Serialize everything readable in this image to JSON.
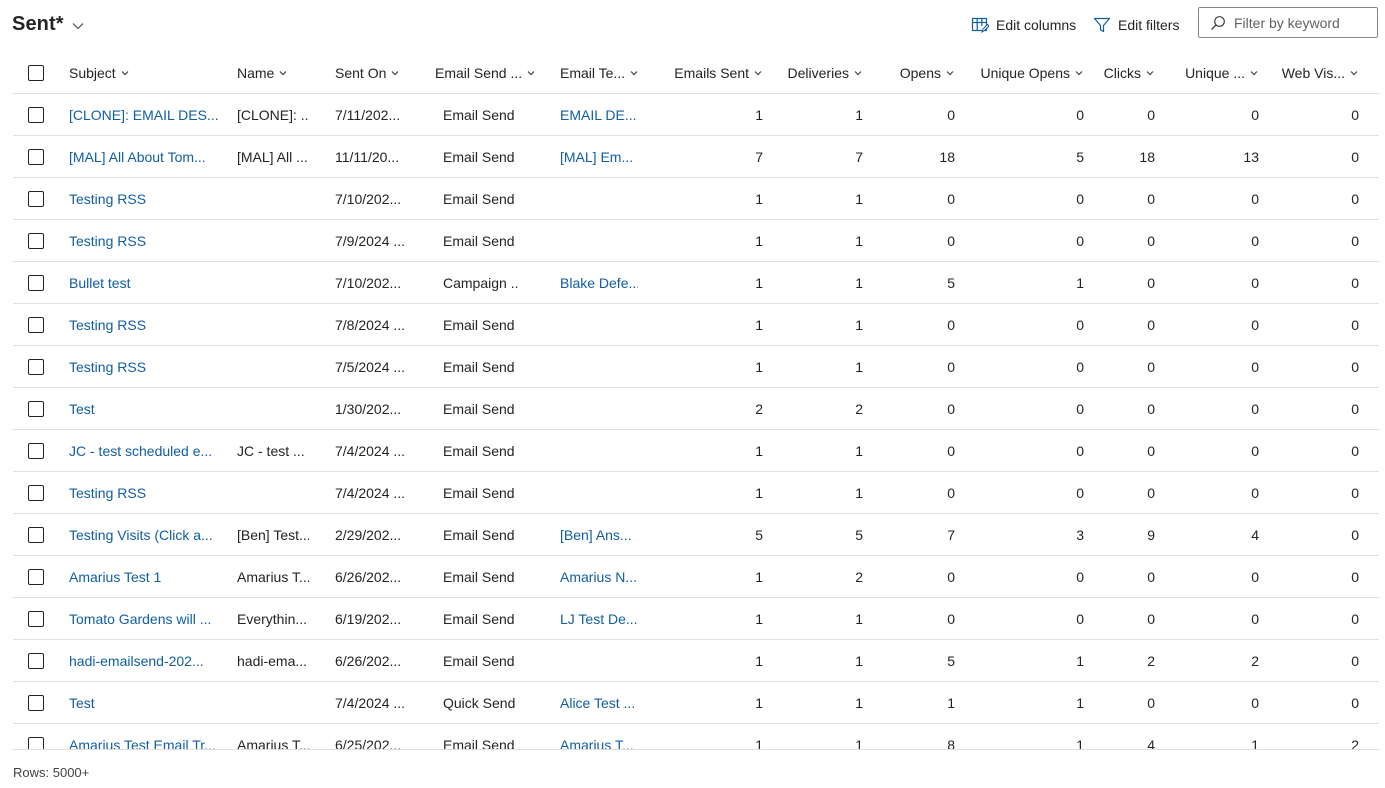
{
  "view": {
    "title": "Sent*"
  },
  "toolbar": {
    "edit_columns": "Edit columns",
    "edit_filters": "Edit filters"
  },
  "search": {
    "placeholder": "Filter by keyword"
  },
  "columns": [
    {
      "key": "subject",
      "label": "Subject"
    },
    {
      "key": "name",
      "label": "Name"
    },
    {
      "key": "sent_on",
      "label": "Sent On"
    },
    {
      "key": "email_send",
      "label": "Email Send ..."
    },
    {
      "key": "email_template",
      "label": "Email Te..."
    },
    {
      "key": "emails_sent",
      "label": "Emails Sent"
    },
    {
      "key": "deliveries",
      "label": "Deliveries"
    },
    {
      "key": "opens",
      "label": "Opens"
    },
    {
      "key": "unique_opens",
      "label": "Unique Opens"
    },
    {
      "key": "clicks",
      "label": "Clicks"
    },
    {
      "key": "unique_clicks",
      "label": "Unique ..."
    },
    {
      "key": "web_visits",
      "label": "Web Vis..."
    }
  ],
  "rows": [
    {
      "subject": "[CLONE]: EMAIL DES...",
      "name": "[CLONE]: ...",
      "sent_on": "7/11/202...",
      "email_send": "Email Send",
      "email_template": "EMAIL DE...",
      "emails_sent": "1",
      "deliveries": "1",
      "opens": "0",
      "unique_opens": "0",
      "clicks": "0",
      "unique_clicks": "0",
      "web_visits": "0"
    },
    {
      "subject": "[MAL] All About Tom...",
      "name": "[MAL] All ...",
      "sent_on": "11/11/20...",
      "email_send": "Email Send",
      "email_template": "[MAL] Em...",
      "emails_sent": "7",
      "deliveries": "7",
      "opens": "18",
      "unique_opens": "5",
      "clicks": "18",
      "unique_clicks": "13",
      "web_visits": "0"
    },
    {
      "subject": "Testing RSS",
      "name": "",
      "sent_on": "7/10/202...",
      "email_send": "Email Send",
      "email_template": "",
      "emails_sent": "1",
      "deliveries": "1",
      "opens": "0",
      "unique_opens": "0",
      "clicks": "0",
      "unique_clicks": "0",
      "web_visits": "0"
    },
    {
      "subject": "Testing RSS",
      "name": "",
      "sent_on": "7/9/2024 ...",
      "email_send": "Email Send",
      "email_template": "",
      "emails_sent": "1",
      "deliveries": "1",
      "opens": "0",
      "unique_opens": "0",
      "clicks": "0",
      "unique_clicks": "0",
      "web_visits": "0"
    },
    {
      "subject": "Bullet test",
      "name": "",
      "sent_on": "7/10/202...",
      "email_send": "Campaign ...",
      "email_template": "Blake Defe...",
      "emails_sent": "1",
      "deliveries": "1",
      "opens": "5",
      "unique_opens": "1",
      "clicks": "0",
      "unique_clicks": "0",
      "web_visits": "0"
    },
    {
      "subject": "Testing RSS",
      "name": "",
      "sent_on": "7/8/2024 ...",
      "email_send": "Email Send",
      "email_template": "",
      "emails_sent": "1",
      "deliveries": "1",
      "opens": "0",
      "unique_opens": "0",
      "clicks": "0",
      "unique_clicks": "0",
      "web_visits": "0"
    },
    {
      "subject": "Testing RSS",
      "name": "",
      "sent_on": "7/5/2024 ...",
      "email_send": "Email Send",
      "email_template": "",
      "emails_sent": "1",
      "deliveries": "1",
      "opens": "0",
      "unique_opens": "0",
      "clicks": "0",
      "unique_clicks": "0",
      "web_visits": "0"
    },
    {
      "subject": "Test",
      "name": "",
      "sent_on": "1/30/202...",
      "email_send": "Email Send",
      "email_template": "",
      "emails_sent": "2",
      "deliveries": "2",
      "opens": "0",
      "unique_opens": "0",
      "clicks": "0",
      "unique_clicks": "0",
      "web_visits": "0"
    },
    {
      "subject": "JC - test scheduled e...",
      "name": "JC - test ...",
      "sent_on": "7/4/2024 ...",
      "email_send": "Email Send",
      "email_template": "",
      "emails_sent": "1",
      "deliveries": "1",
      "opens": "0",
      "unique_opens": "0",
      "clicks": "0",
      "unique_clicks": "0",
      "web_visits": "0"
    },
    {
      "subject": "Testing RSS",
      "name": "",
      "sent_on": "7/4/2024 ...",
      "email_send": "Email Send",
      "email_template": "",
      "emails_sent": "1",
      "deliveries": "1",
      "opens": "0",
      "unique_opens": "0",
      "clicks": "0",
      "unique_clicks": "0",
      "web_visits": "0"
    },
    {
      "subject": "Testing Visits (Click a...",
      "name": "[Ben] Test...",
      "sent_on": "2/29/202...",
      "email_send": "Email Send",
      "email_template": "[Ben] Ans...",
      "emails_sent": "5",
      "deliveries": "5",
      "opens": "7",
      "unique_opens": "3",
      "clicks": "9",
      "unique_clicks": "4",
      "web_visits": "0"
    },
    {
      "subject": "Amarius Test 1",
      "name": "Amarius T...",
      "sent_on": "6/26/202...",
      "email_send": "Email Send",
      "email_template": "Amarius N...",
      "emails_sent": "1",
      "deliveries": "2",
      "opens": "0",
      "unique_opens": "0",
      "clicks": "0",
      "unique_clicks": "0",
      "web_visits": "0"
    },
    {
      "subject": "Tomato Gardens will ...",
      "name": "Everythin...",
      "sent_on": "6/19/202...",
      "email_send": "Email Send",
      "email_template": "LJ Test De...",
      "emails_sent": "1",
      "deliveries": "1",
      "opens": "0",
      "unique_opens": "0",
      "clicks": "0",
      "unique_clicks": "0",
      "web_visits": "0"
    },
    {
      "subject": "hadi-emailsend-202...",
      "name": "hadi-ema...",
      "sent_on": "6/26/202...",
      "email_send": "Email Send",
      "email_template": "",
      "emails_sent": "1",
      "deliveries": "1",
      "opens": "5",
      "unique_opens": "1",
      "clicks": "2",
      "unique_clicks": "2",
      "web_visits": "0"
    },
    {
      "subject": "Test",
      "name": "",
      "sent_on": "7/4/2024 ...",
      "email_send": "Quick Send",
      "email_template": "Alice Test ...",
      "emails_sent": "1",
      "deliveries": "1",
      "opens": "1",
      "unique_opens": "1",
      "clicks": "0",
      "unique_clicks": "0",
      "web_visits": "0"
    },
    {
      "subject": "Amarius Test Email Tr...",
      "name": "Amarius T...",
      "sent_on": "6/25/202...",
      "email_send": "Email Send",
      "email_template": "Amarius T...",
      "emails_sent": "1",
      "deliveries": "1",
      "opens": "8",
      "unique_opens": "1",
      "clicks": "4",
      "unique_clicks": "1",
      "web_visits": "2"
    }
  ],
  "footer": {
    "rows_label": "Rows: 5000+"
  },
  "colors": {
    "link": "#115ea3",
    "text": "#242424",
    "border": "#e1dfdd"
  },
  "icons": {
    "view_selector": "chevron-down-icon",
    "edit_columns": "edit-columns-icon",
    "edit_filters": "filter-icon",
    "search": "search-icon",
    "sort": "chevron-down-icon"
  }
}
